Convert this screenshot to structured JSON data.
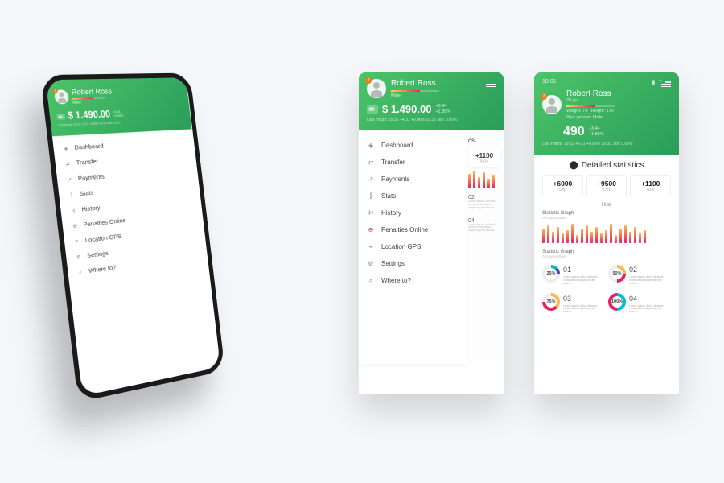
{
  "status": {
    "time": "18:01",
    "icons": [
      "signal",
      "wifi",
      "battery"
    ]
  },
  "user": {
    "name": "Robert Ross",
    "age_label": "28 yrs",
    "weight_label": "Weight: 74",
    "height_label": "Height: 170",
    "gender_label": "Your gender:  Male",
    "badge": "2"
  },
  "balance": {
    "amount": "$ 1.490.00",
    "delta_abs": "+3.44",
    "delta_pct": "+1.88%",
    "footnote": "Last Hours: 19:31 +4:31  +0.06%   19:35 Jan:  0.09%"
  },
  "score": {
    "value": "490",
    "delta_abs": "+3.44",
    "delta_pct": "+1.88%"
  },
  "menu": {
    "items": [
      {
        "icon": "◈",
        "label": "Dashboard"
      },
      {
        "icon": "⇄",
        "label": "Transfer"
      },
      {
        "icon": "↗",
        "label": "Payments"
      },
      {
        "icon": "⫿",
        "label": "Stats"
      },
      {
        "icon": "H",
        "label": "History"
      },
      {
        "icon": "⊖",
        "label": "Penalties Online",
        "red": true
      },
      {
        "icon": "⌖",
        "label": "Location  GPS"
      },
      {
        "icon": "⚙",
        "label": "Settings"
      },
      {
        "icon": "⌕",
        "label": "Where to?"
      }
    ]
  },
  "stats": {
    "title": "Detailed statistics",
    "chips": [
      {
        "value": "+6000",
        "month": "Sep"
      },
      {
        "value": "+9500",
        "month": "Oct"
      },
      {
        "value": "+1100",
        "month": "Nov"
      }
    ],
    "hide": "Hide",
    "graph1": {
      "title": "Statistic Graph",
      "sub": "All transactions"
    },
    "graph2": {
      "title": "Statistic Graph",
      "sub": "All transactions"
    },
    "donuts": [
      {
        "pct": "25%",
        "idx": "01",
        "colors": [
          "#00bcd4",
          "#3f51b5"
        ]
      },
      {
        "pct": "50%",
        "idx": "02",
        "colors": [
          "#ffb74d",
          "#e91e63"
        ]
      },
      {
        "pct": "75%",
        "idx": "03",
        "colors": [
          "#ffb74d",
          "#e91e63"
        ]
      },
      {
        "pct": "100%",
        "idx": "04",
        "colors": [
          "#00bcd4",
          "#ffb74d",
          "#e91e63"
        ]
      }
    ],
    "lorem": "Lorem ipsum dolor sit amet, consectetur adipiscing elit sed do"
  },
  "chart_data": {
    "type": "bar",
    "title": "Statistic Graph",
    "series": [
      {
        "name": "All transactions",
        "values": [
          18,
          22,
          14,
          20,
          12,
          16,
          24,
          10,
          18,
          22,
          14,
          20,
          12,
          16,
          24,
          10,
          18,
          22,
          14,
          20,
          12,
          16
        ]
      }
    ],
    "ylim": [
      0,
      26
    ]
  },
  "back_panel": {
    "title_frag": "cs",
    "chip_value": "+1100",
    "chip_month": "Nov",
    "idx2": "02",
    "idx4": "04"
  }
}
